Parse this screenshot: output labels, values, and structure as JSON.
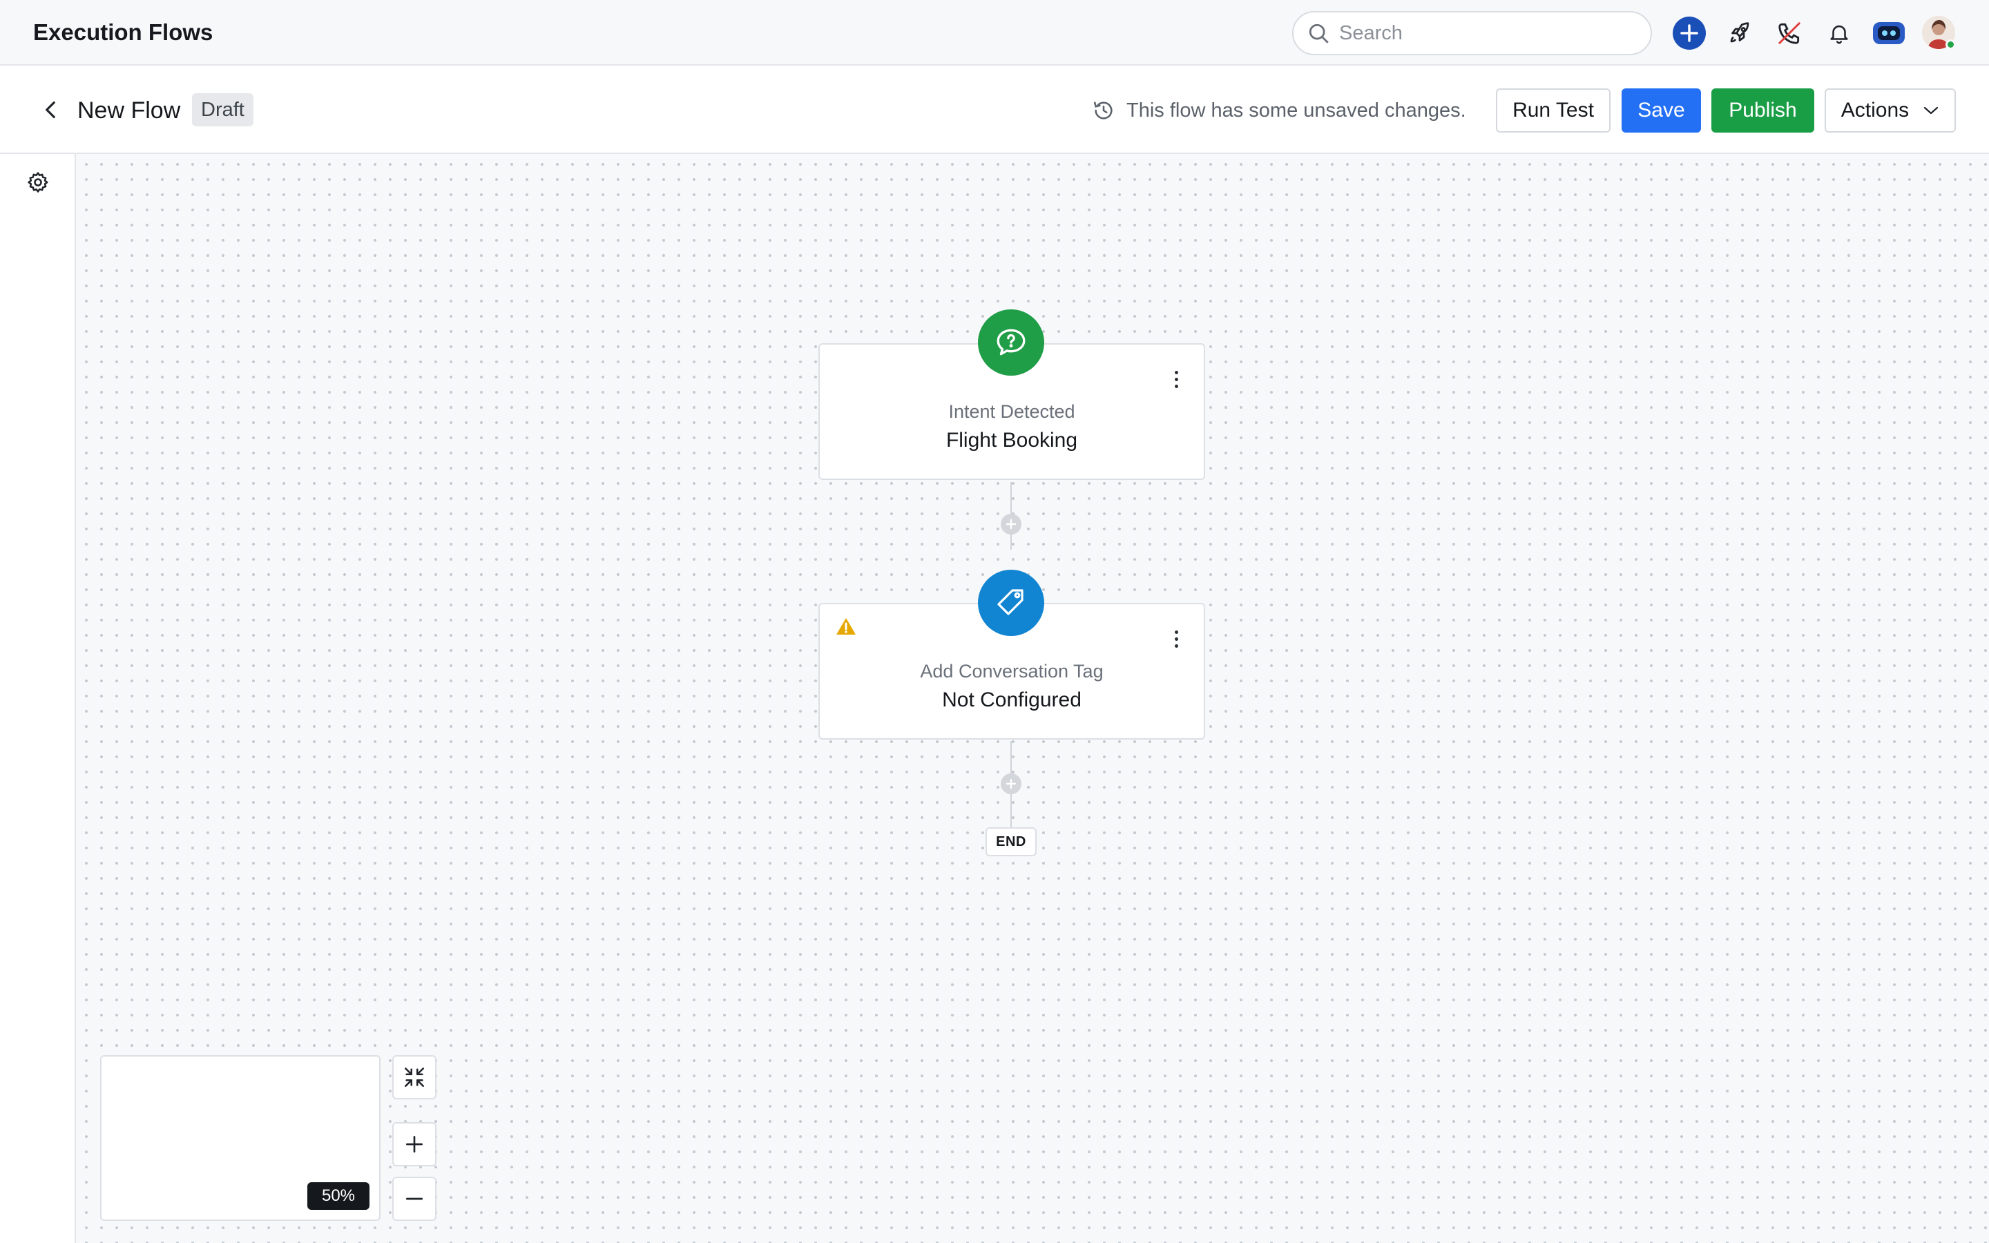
{
  "app": {
    "title": "Execution Flows"
  },
  "search": {
    "placeholder": "Search"
  },
  "top_icons": [
    "plus-circle-icon",
    "rocket-icon",
    "phone-missed-icon",
    "bell-icon",
    "bot-icon",
    "user-avatar"
  ],
  "flow": {
    "name": "New Flow",
    "status": "Draft",
    "unsaved_message": "This flow has some unsaved changes.",
    "buttons": {
      "run_test": "Run Test",
      "save": "Save",
      "publish": "Publish",
      "actions": "Actions"
    }
  },
  "nodes": [
    {
      "type_label": "Intent Detected",
      "value": "Flight Booking",
      "icon": "chat-question-icon",
      "color": "#1f9d47",
      "warning": false
    },
    {
      "type_label": "Add Conversation Tag",
      "value": "Not Configured",
      "icon": "tag-icon",
      "color": "#1285d2",
      "warning": true
    }
  ],
  "end_label": "END",
  "zoom": {
    "level": "50%"
  },
  "colors": {
    "primary": "#2470f4",
    "publish": "#1a9e45",
    "intent": "#1f9d47",
    "tag": "#1285d2",
    "warning": "#e6a700"
  }
}
